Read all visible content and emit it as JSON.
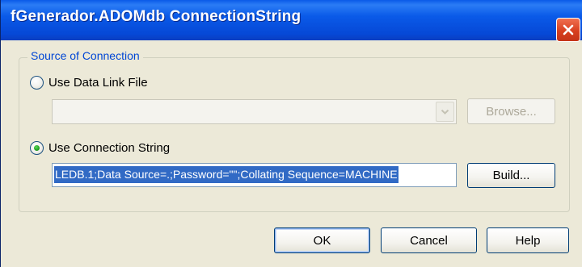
{
  "window": {
    "title": "fGenerador.ADOMdb ConnectionString",
    "close_icon": "close-icon"
  },
  "group": {
    "legend": "Source of Connection"
  },
  "data_link": {
    "label": "Use Data Link File",
    "selected": false,
    "file_value": "",
    "browse_label": "Browse...",
    "browse_enabled": false
  },
  "connection_string": {
    "label": "Use Connection String",
    "selected": true,
    "value": "LEDB.1;Data Source=.;Password=\"\";Collating Sequence=MACHINE",
    "build_label": "Build..."
  },
  "buttons": {
    "ok": "OK",
    "cancel": "Cancel",
    "help": "Help"
  },
  "colors": {
    "title_bar": "#0a5ae8",
    "dialog_face": "#ece9d8",
    "legend_text": "#0046d5",
    "selection": "#316ac5",
    "close_button": "#d84020"
  }
}
